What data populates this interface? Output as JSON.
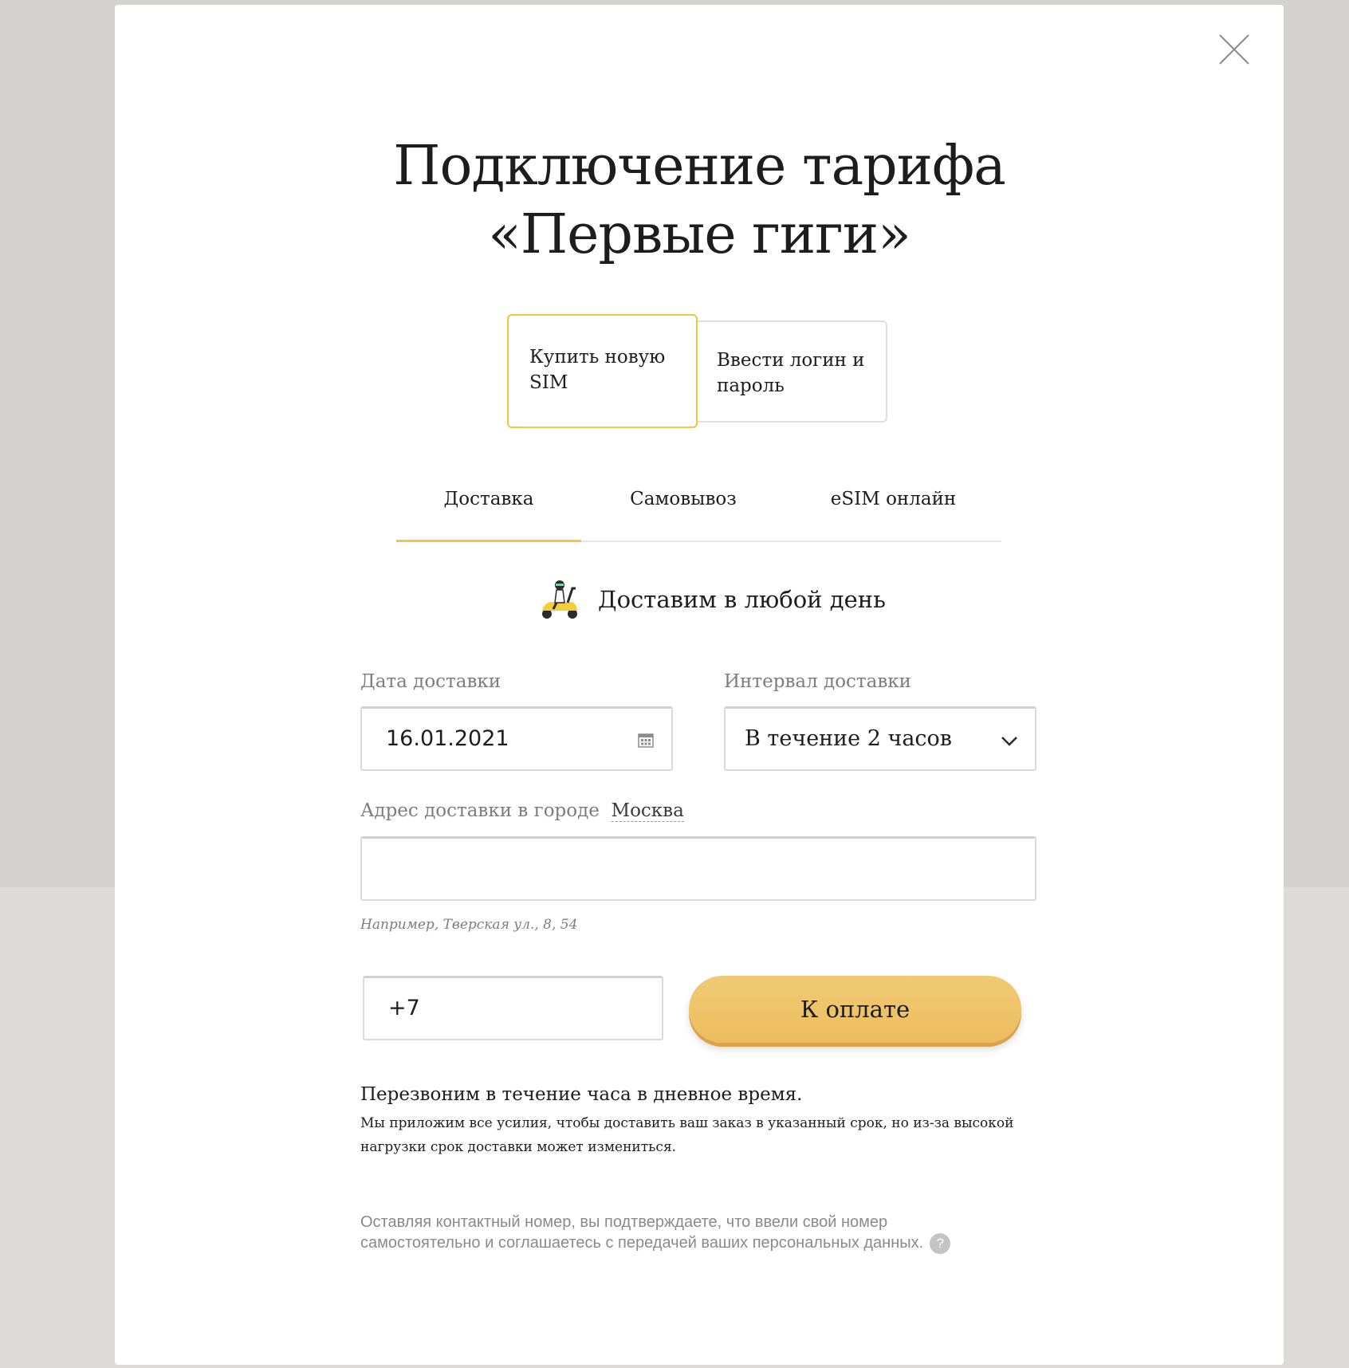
{
  "modal": {
    "title_line1": "Подключение тарифа",
    "title_line2": "«Первые гиги»"
  },
  "mode_choices": [
    {
      "label": "Купить новую SIM",
      "selected": true
    },
    {
      "label": "Ввести логин и пароль",
      "selected": false
    }
  ],
  "tabs": [
    {
      "label": "Доставка",
      "active": true
    },
    {
      "label": "Самовывоз",
      "active": false
    },
    {
      "label": "eSIM онлайн",
      "active": false
    }
  ],
  "promo": {
    "icon": "scooter-icon",
    "text": "Доставим в любой день"
  },
  "form": {
    "date_label": "Дата доставки",
    "date_value": "16.01.2021",
    "interval_label": "Интервал доставки",
    "interval_value": "В течение 2 часов",
    "address_label": "Адрес доставки в городе",
    "city": "Москва",
    "address_value": "",
    "address_hint": "Например, Тверская ул., 8, 54",
    "phone_value": "+7",
    "submit_label": "К оплате"
  },
  "callback": {
    "title": "Перезвоним в течение часа в дневное время.",
    "text": "Мы приложим все усилия, чтобы доставить ваш заказ в указанный срок, но из-за высокой нагрузки срок доставки может измениться."
  },
  "consent": {
    "text": "Оставляя контактный номер, вы подтверждаете, что ввели свой номер самостоятельно и соглашаетесь с передачей ваших персональных данных.",
    "help_icon": "?"
  },
  "colors": {
    "accent": "#f0c646",
    "button": "#ecbd5d",
    "backdrop": "#d3d2cf"
  }
}
